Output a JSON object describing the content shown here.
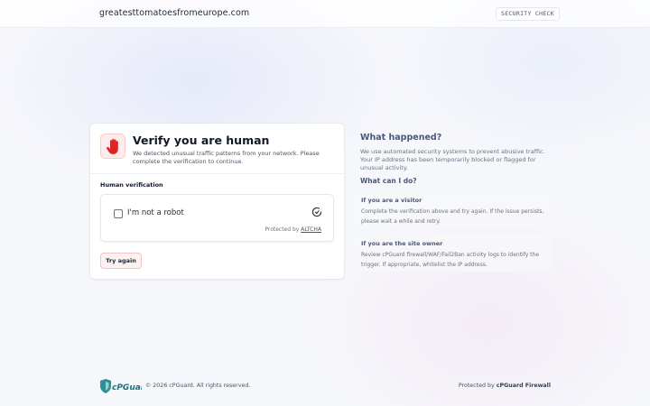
{
  "header": {
    "domain": "greatesttomatoesfromeurope.com",
    "badge": "SECURITY CHECK"
  },
  "card": {
    "icon": "hand-stop-icon",
    "title": "Verify you are human",
    "description": "We detected unusual traffic patterns from your network. Please complete the verification to continue.",
    "section_label": "Human verification",
    "captcha": {
      "checkbox_label": "I'm not a robot",
      "checked": false,
      "protected_prefix": "Protected by",
      "provider": "ALTCHA",
      "icon": "altcha-logo-icon"
    },
    "retry_label": "Try again"
  },
  "side": {
    "title": "What happened?",
    "description": "We use automated security systems to prevent abusive traffic. Your IP address has been temporarily blocked or flagged for unusual activity.",
    "subtitle": "What can I do?",
    "items": [
      {
        "title": "If you are a visitor",
        "text": "Complete the verification above and try again. If the issue persists, please wait a while and retry."
      },
      {
        "title": "If you are the site owner",
        "text": "Review cPGuard firewall/WAF/Fail2Ban activity logs to identify the trigger. If appropriate, whitelist the IP address."
      }
    ]
  },
  "footer": {
    "logo": "cPGuard",
    "copyright": "© 2026 cPGuard. All rights reserved.",
    "protected_prefix": "Protected by",
    "protected_brand": "cPGuard Firewall"
  },
  "colors": {
    "accent_red": "#dc2626",
    "muted_blue": "#4b5878",
    "logo_teal": "#2f8f93"
  }
}
